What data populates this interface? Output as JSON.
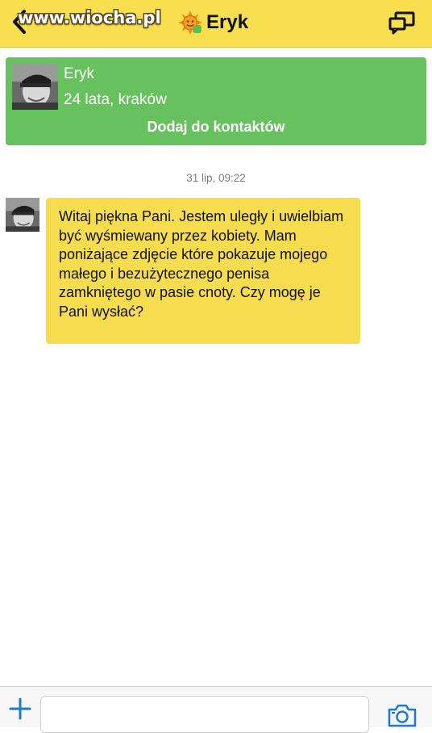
{
  "header": {
    "watermark": "www.wiocha.pl",
    "title": "Eryk",
    "icons": {
      "back": "chevron-left-icon",
      "sun": "sun-status-icon",
      "switch": "switch-chats-icon"
    },
    "accent_color": "#f7df4f"
  },
  "profile": {
    "name": "Eryk",
    "details": "24 lata, kraków",
    "add_button_label": "Dodaj do kontaktów",
    "card_color": "#67c15e"
  },
  "conversation": {
    "timestamp": "31 lip, 09:22",
    "messages": [
      {
        "sender": "Eryk",
        "text": "Witaj piękna Pani. Jestem uległy i uwielbiam być wyśmiewany przez kobiety. Mam poniżające zdjęcie które pokazuje mojego małego i bezużytecznego penisa zamkniętego w pasie cnoty. Czy mogę je Pani wysłać?",
        "bubble_color": "#f6dd4f"
      }
    ]
  },
  "composer": {
    "placeholder": "",
    "value": "",
    "icons": {
      "add": "plus-icon",
      "camera": "camera-icon"
    },
    "icon_color": "#1f78d1"
  }
}
